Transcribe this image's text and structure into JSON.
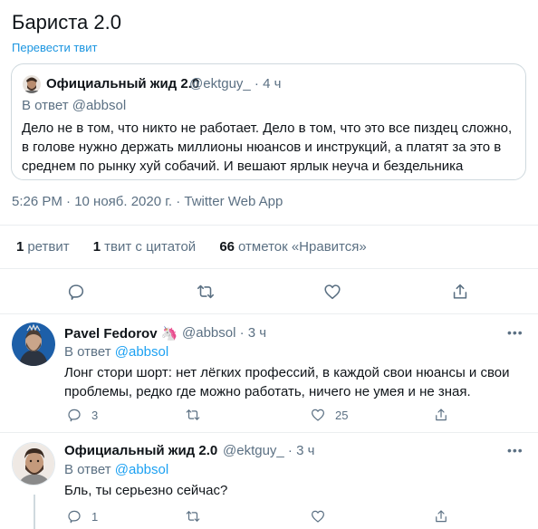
{
  "tweet": {
    "text": "Бариста 2.0",
    "translate_label": "Перевести твит",
    "meta": "5:26 PM · 10 нояб. 2020 г. · Twitter Web App"
  },
  "quote": {
    "name": "Официальный жид 2.0",
    "handle": "@ektguy_ · 4 ч",
    "reply_to": "В ответ @abbsol",
    "body": "Дело не в том, что никто не работает. Дело в том, что это все пиздец сложно, в голове нужно держать миллионы нюансов и инструкций, а платят за это в среднем по рынку хуй собачий. И вешают ярлык неуча и бездельника"
  },
  "stats": {
    "retweets_count": "1",
    "retweets_label": "ретвит",
    "quotes_count": "1",
    "quotes_label": "твит с цитатой",
    "likes_count": "66",
    "likes_label": "отметок «Нравится»"
  },
  "actions": {
    "icons": [
      "reply-icon",
      "retweet-icon",
      "like-icon",
      "share-icon"
    ]
  },
  "replies": [
    {
      "name": "Pavel Fedorov",
      "name_emoji": "🦄",
      "handle": "@abbsol · 3 ч",
      "reply_prefix": "В ответ ",
      "reply_handle": "@abbsol",
      "text": "Лонг стори шорт: нет лёгких профессий, в каждой свои нюансы и свои проблемы, редко где можно работать, ничего не умея и не зная.",
      "reply_count": "3",
      "retweet_count": "",
      "like_count": "25"
    },
    {
      "name": "Официальный жид 2.0",
      "handle": "@ektguy_ · 3 ч",
      "reply_prefix": "В ответ ",
      "reply_handle": "@abbsol",
      "text": "Бль, ты серьезно сейчас?",
      "reply_count": "1",
      "retweet_count": "",
      "like_count": ""
    }
  ],
  "more_label": "•••",
  "colors": {
    "accent": "#1da1f2",
    "muted": "#5b7083",
    "border": "#cfd9de",
    "divider": "#ebeef0",
    "text": "#0f1419"
  }
}
